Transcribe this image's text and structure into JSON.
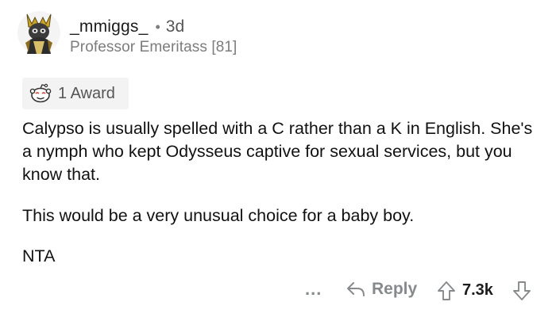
{
  "comment": {
    "username": "_mmiggs_",
    "separator": "•",
    "age": "3d",
    "flair": "Professor Emeritass [81]",
    "award": {
      "icon": "award-face-icon",
      "label": "1 Award"
    },
    "paragraphs": [
      "Calypso is usually spelled with a C rather than a K in English. She's a nymph who kept Odysseus captive for sexual services, but you know that.",
      "This would be a very unusual choice for a baby boy.",
      "NTA"
    ],
    "actions": {
      "more_label": "...",
      "reply_label": "Reply",
      "score": "7.3k"
    }
  },
  "colors": {
    "text": "#1c1c1c",
    "muted": "#7c7c7c",
    "action": "#878a8c",
    "award_bg": "#f3f3f3"
  }
}
